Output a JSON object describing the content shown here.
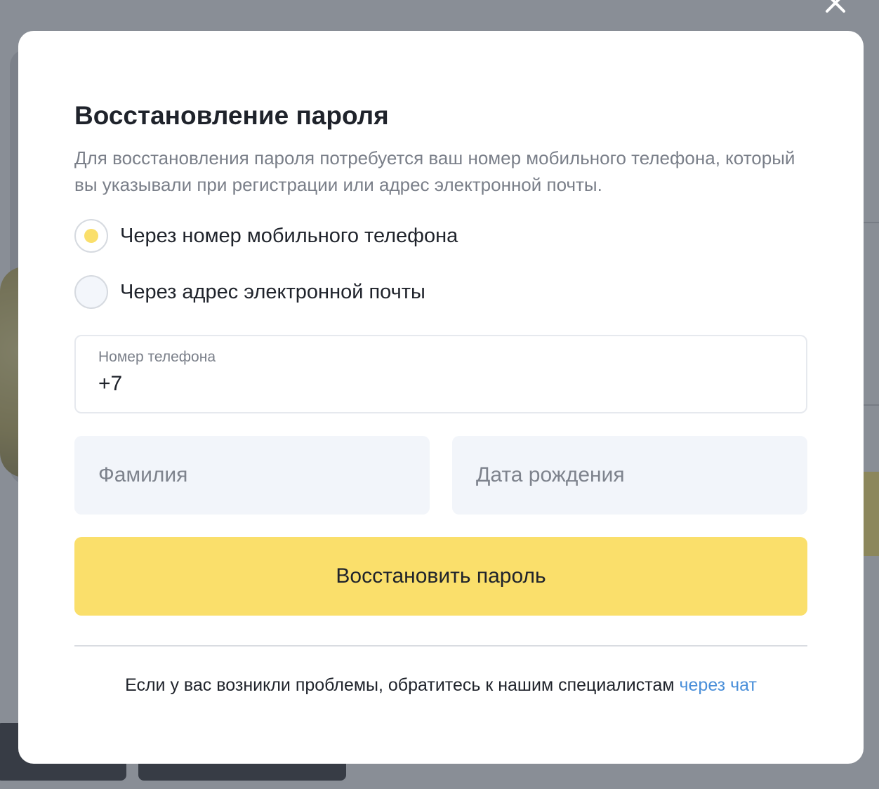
{
  "modal": {
    "title": "Восстановление пароля",
    "description": "Для восстановления пароля потребуется ваш номер мобильного телефона, который вы указывали при регистрации или адрес электронной почты.",
    "close_icon": "close-icon"
  },
  "recovery_method": {
    "options": [
      {
        "label": "Через номер мобильного телефона",
        "selected": true
      },
      {
        "label": "Через адрес электронной почты",
        "selected": false
      }
    ]
  },
  "form": {
    "phone": {
      "label": "Номер телефона",
      "value": "+7"
    },
    "surname": {
      "placeholder": "Фамилия"
    },
    "birthdate": {
      "placeholder": "Дата рождения"
    },
    "submit_label": "Восстановить пароль"
  },
  "help": {
    "text": "Если у вас возникли проблемы, обратитесь к нашим специалистам ",
    "link_text": "через чат"
  },
  "colors": {
    "accent": "#fadf6b",
    "link": "#4a8fd9",
    "title": "#1f232b",
    "muted": "#7a7f89"
  }
}
